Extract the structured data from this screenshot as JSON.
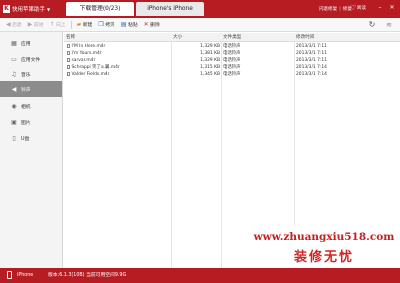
{
  "app": {
    "logo_text": "快用苹果助手",
    "logo_mark": "K"
  },
  "tabs": [
    {
      "label": "下载管理(0/23)"
    },
    {
      "label": "iPhone's iPhone"
    }
  ],
  "titlebar": {
    "group1": "闪退",
    "group2": "修复",
    "group3": "修复",
    "recv_label": "阅读"
  },
  "toolbar": {
    "back": "后退",
    "forward": "前进",
    "up": "向上",
    "new_folder": "新建",
    "copy": "拷贝",
    "paste": "粘贴",
    "delete": "删除"
  },
  "sidebar": {
    "items": [
      {
        "label": "应用",
        "icon": "apps-icon"
      },
      {
        "label": "应用文件",
        "icon": "folder-icon"
      },
      {
        "label": "音乐",
        "icon": "music-icon"
      },
      {
        "label": "铃声",
        "icon": "ringtone-icon"
      },
      {
        "label": "相机",
        "icon": "camera-icon"
      },
      {
        "label": "图片",
        "icon": "picture-icon"
      },
      {
        "label": "U盘",
        "icon": "usb-icon"
      }
    ]
  },
  "table": {
    "headers": {
      "name": "名称",
      "size": "大小",
      "type": "文件类型",
      "date": "修改时间"
    },
    "rows": [
      {
        "name": "I'M In Here.m4r",
        "size": "1,329 KB",
        "type": "电话铃声",
        "date": "2013/3/1 7:11"
      },
      {
        "name": "I'm Yours.m4r",
        "size": "1,381 KB",
        "type": "电话铃声",
        "date": "2013/3/1 7:11"
      },
      {
        "name": "sarvar.m4r",
        "size": "1,329 KB",
        "type": "电话铃声",
        "date": "2013/3/1 7:11"
      },
      {
        "name": "Schrappi   笑了a.翼.m4r",
        "size": "1,315 KB",
        "type": "电话铃声",
        "date": "2013/3/1 7:14"
      },
      {
        "name": "Valder Fields.m4r",
        "size": "1,345 KB",
        "type": "电话铃声",
        "date": "2013/3/1 7:14"
      }
    ]
  },
  "watermark": {
    "url": "www.zhuangxiu518.com",
    "title": "装修无忧"
  },
  "status": {
    "device": "iPhone",
    "info": "版本:6.1.3(10B) 当前可用空间9.9G"
  },
  "colors": {
    "brand_red": "#b61c22",
    "sidebar_active": "#8c8c8c"
  }
}
